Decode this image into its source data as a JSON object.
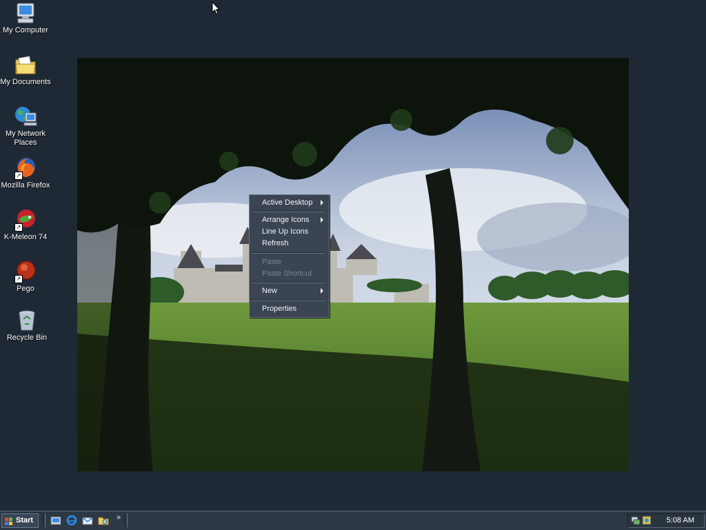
{
  "desktop": {
    "icons": [
      {
        "label": "My Computer",
        "icon": "my-computer-icon"
      },
      {
        "label": "My Documents",
        "icon": "my-documents-icon"
      },
      {
        "label": "My Network Places",
        "icon": "network-places-icon"
      },
      {
        "label": "Mozilla Firefox",
        "icon": "firefox-icon"
      },
      {
        "label": "K-Meleon 74",
        "icon": "kmeleon-icon"
      },
      {
        "label": "Pego",
        "icon": "pego-icon"
      },
      {
        "label": "Recycle Bin",
        "icon": "recycle-bin-icon"
      }
    ]
  },
  "context_menu": {
    "items": [
      {
        "label": "Active Desktop",
        "submenu": true,
        "enabled": true
      },
      {
        "label": "Arrange Icons",
        "submenu": true,
        "enabled": true
      },
      {
        "label": "Line Up Icons",
        "submenu": false,
        "enabled": true
      },
      {
        "label": "Refresh",
        "submenu": false,
        "enabled": true
      },
      {
        "label": "Paste",
        "submenu": false,
        "enabled": false
      },
      {
        "label": "Paste Shortcut",
        "submenu": false,
        "enabled": false
      },
      {
        "label": "New",
        "submenu": true,
        "enabled": true
      },
      {
        "label": "Properties",
        "submenu": false,
        "enabled": true
      }
    ]
  },
  "taskbar": {
    "start_label": "Start",
    "quick_launch": [
      "show-desktop-icon",
      "internet-explorer-icon",
      "outlook-express-icon",
      "windows-explorer-icon"
    ],
    "more_label": "»",
    "tray_icons": [
      "network-tray-icon",
      "security-tray-icon"
    ],
    "clock": "5:08 AM"
  },
  "colors": {
    "desktop_bg": "#1f2935",
    "menu_bg": "#3a4452",
    "taskbar_bg": "#2d3845"
  }
}
